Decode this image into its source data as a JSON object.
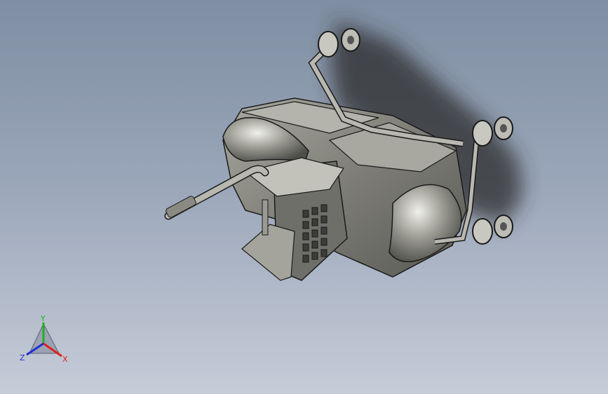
{
  "viewport": {
    "background_top": "#7f8ea3",
    "background_bottom": "#c6ccd8"
  },
  "model": {
    "kind": "3d-cad-render",
    "subject": "shopping-cart-assembly",
    "body_color": "#8c8c84",
    "edge_color": "#1a1a1a",
    "shadow_color": "#2b2b2b"
  },
  "triad": {
    "x_label": "X",
    "y_label": "Y",
    "z_label": "Z",
    "x_color": "#e02020",
    "y_color": "#20b020",
    "z_color": "#2030d0"
  }
}
